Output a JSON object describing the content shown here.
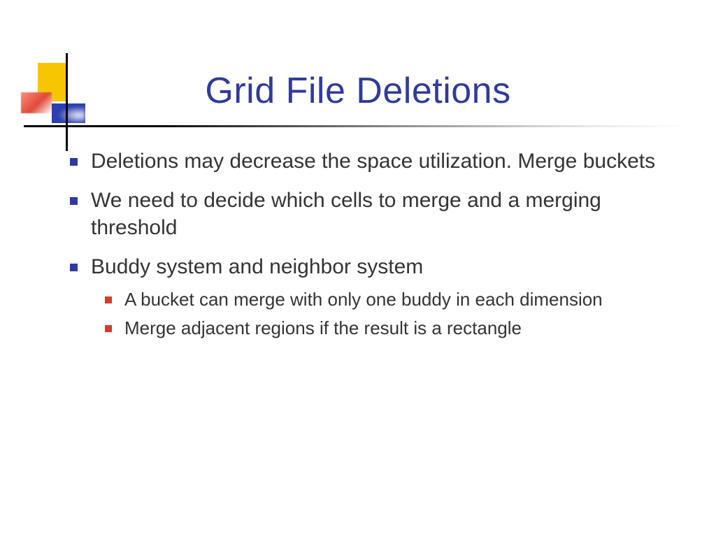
{
  "title": "Grid File Deletions",
  "bullets": [
    {
      "text": "Deletions may decrease the space utilization. Merge buckets"
    },
    {
      "text": "We need to decide which cells to merge and a merging threshold"
    },
    {
      "text": "Buddy system and neighbor system",
      "sub": [
        "A bucket can merge with only one buddy in each dimension",
        "Merge adjacent regions if the result is a rectangle"
      ]
    }
  ]
}
